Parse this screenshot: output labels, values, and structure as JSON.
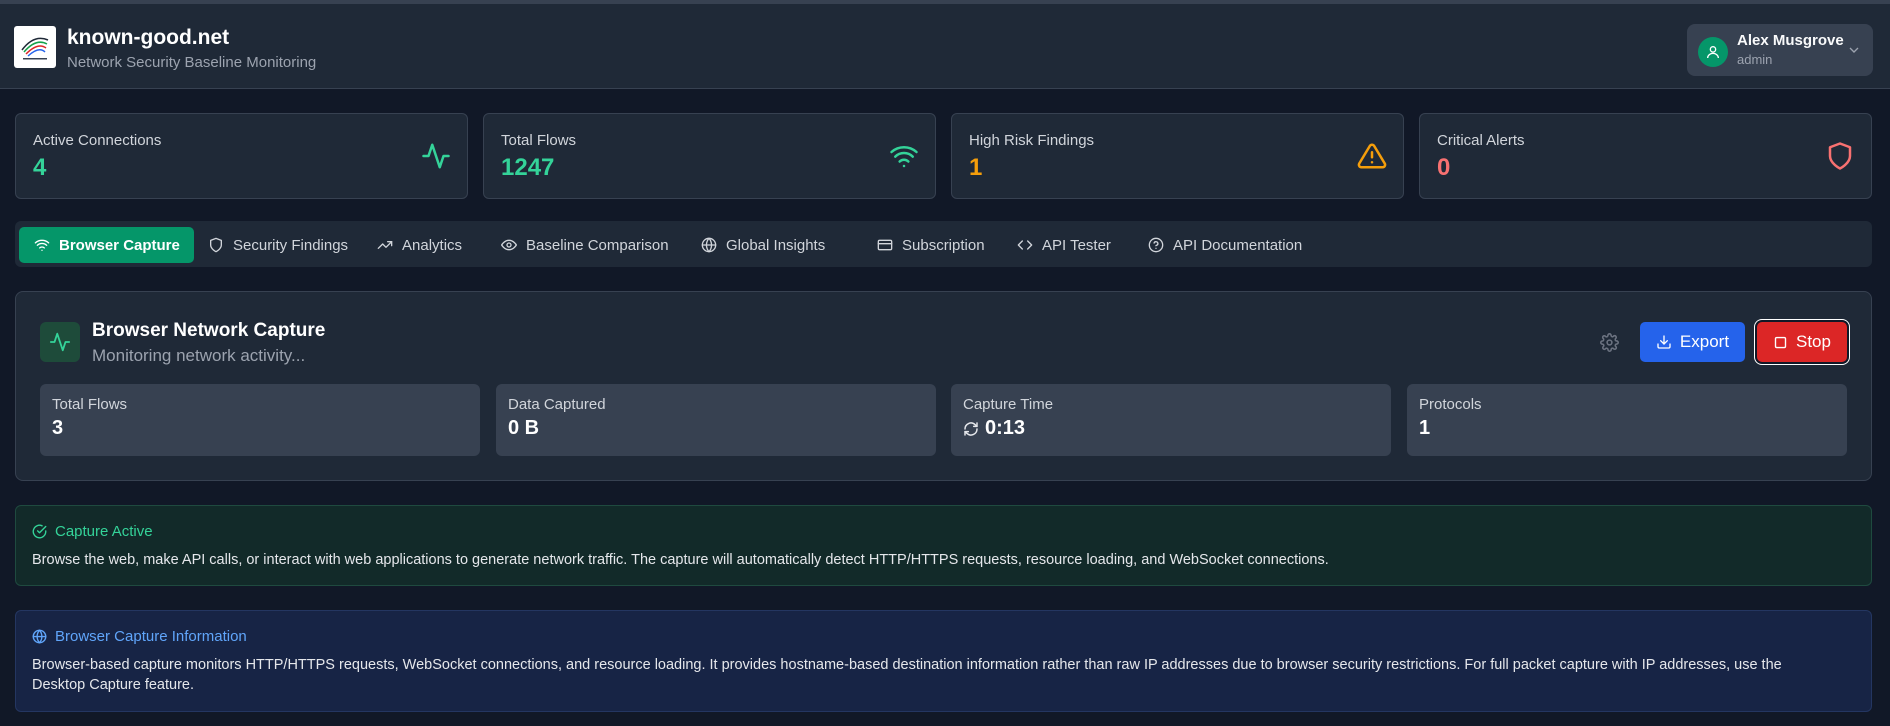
{
  "header": {
    "site_name": "known-good.net",
    "tagline": "Network Security Baseline Monitoring",
    "user": {
      "name": "Alex Musgrove",
      "role": "admin"
    }
  },
  "stats": [
    {
      "label": "Active Connections",
      "value": "4",
      "color": "#34d399",
      "icon": "activity-icon"
    },
    {
      "label": "Total Flows",
      "value": "1247",
      "color": "#34d399",
      "icon": "wifi-icon"
    },
    {
      "label": "High Risk Findings",
      "value": "1",
      "color": "#f59e0b",
      "icon": "warning-triangle-icon"
    },
    {
      "label": "Critical Alerts",
      "value": "0",
      "color": "#f87171",
      "icon": "shield-icon"
    }
  ],
  "tabs": [
    {
      "label": "Browser Capture",
      "icon": "wifi-icon",
      "active": true
    },
    {
      "label": "Security Findings",
      "icon": "shield-icon"
    },
    {
      "label": "Analytics",
      "icon": "trending-up-icon"
    },
    {
      "label": "Baseline Comparison",
      "icon": "eye-icon"
    },
    {
      "label": "Global Insights",
      "icon": "globe-icon"
    },
    {
      "label": "Subscription",
      "icon": "credit-card-icon"
    },
    {
      "label": "API Tester",
      "icon": "code-icon"
    },
    {
      "label": "API Documentation",
      "icon": "help-circle-icon"
    }
  ],
  "capture": {
    "title": "Browser Network Capture",
    "status": "Monitoring network activity...",
    "export_label": "Export",
    "stop_label": "Stop",
    "metrics": [
      {
        "label": "Total Flows",
        "value": "3"
      },
      {
        "label": "Data Captured",
        "value": "0 B"
      },
      {
        "label": "Capture Time",
        "value": "0:13",
        "icon": "refresh-icon"
      },
      {
        "label": "Protocols",
        "value": "1"
      }
    ]
  },
  "notices": {
    "active": {
      "title": "Capture Active",
      "text": "Browse the web, make API calls, or interact with web applications to generate network traffic. The capture will automatically detect HTTP/HTTPS requests, resource loading, and WebSocket connections.",
      "color": "#34d399"
    },
    "browser_info": {
      "title": "Browser Capture Information",
      "text_line1": "Browser-based capture monitors HTTP/HTTPS requests, WebSocket connections, and resource loading. It provides hostname-based destination information rather than raw IP addresses due to browser security restrictions. For full packet capture with IP addresses, use the",
      "text_line2": "Desktop Capture feature.",
      "color": "#60a5fa"
    }
  },
  "colors": {
    "accent_green": "#059669",
    "export_blue": "#2563eb",
    "stop_red": "#dc2626"
  }
}
